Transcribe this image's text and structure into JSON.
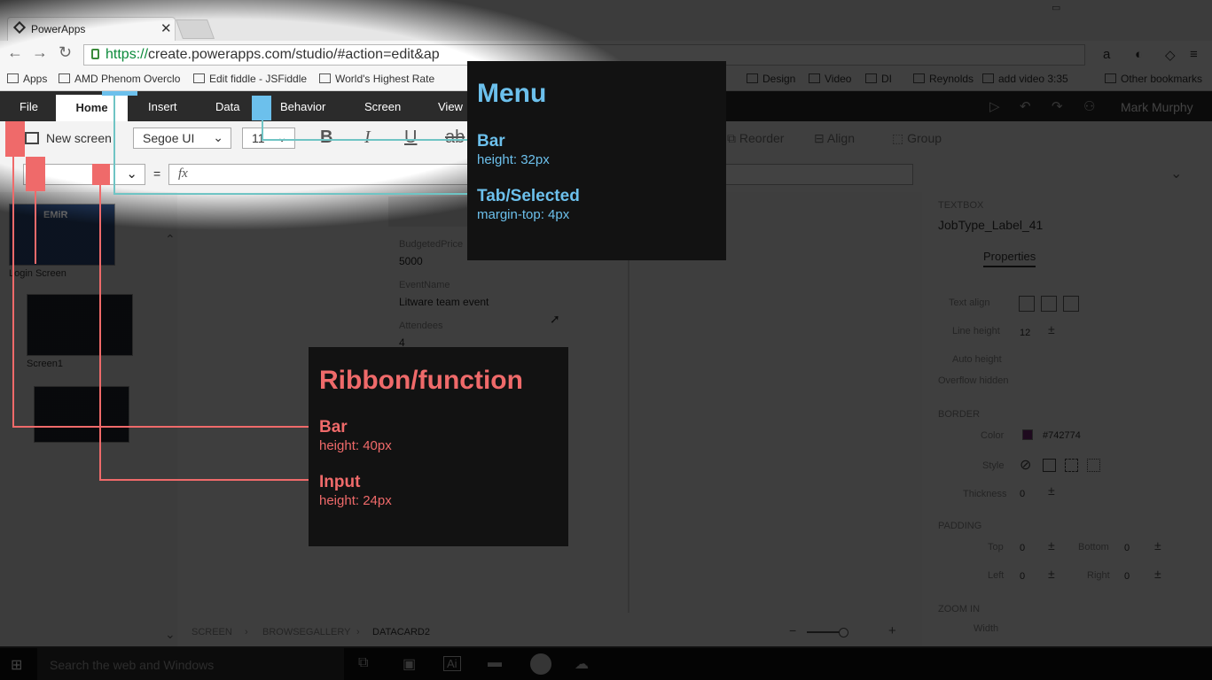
{
  "browser": {
    "tab_title": "PowerApps",
    "url_scheme": "https://",
    "url_rest": "create.powerapps.com/studio/#action=edit&ap",
    "bookmarks": [
      "Apps",
      "AMD Phenom Overclo",
      "Edit fiddle - JSFiddle",
      "World's Highest Rate",
      "Design",
      "Video",
      "DI",
      "Reynolds",
      "add video 3:35",
      "Other bookmarks"
    ]
  },
  "app": {
    "tabs": [
      "File",
      "Home",
      "Insert",
      "Data",
      "Behavior",
      "Screen",
      "View"
    ],
    "selected_tab": "Home",
    "user": "Mark Murphy",
    "ribbon": {
      "new_screen": "New screen",
      "font": "Segoe UI",
      "size": "11",
      "bold": "B",
      "italic": "I",
      "underline": "U",
      "strike": "ab",
      "reorder": "Reorder",
      "align": "Align",
      "group": "Group"
    },
    "formula": {
      "equals": "=",
      "fx": "fx"
    },
    "screens": [
      "Login Screen",
      "Screen1"
    ],
    "thumb_brand": "EMiR",
    "form": [
      {
        "label": "BudgetedPrice",
        "value": "5000"
      },
      {
        "label": "EventName",
        "value": "Litware team event"
      },
      {
        "label": "Attendees",
        "value": "4"
      }
    ],
    "properties": {
      "control_type": "TEXTBOX",
      "control_name": "JobType_Label_41",
      "tab": "Properties",
      "text_align": "Text align",
      "line_height_label": "Line height",
      "line_height": "12",
      "auto_height": "Auto height",
      "overflow": "Overflow hidden",
      "border_section": "BORDER",
      "color_label": "Color",
      "color_value": "#742774",
      "style_label": "Style",
      "thickness_label": "Thickness",
      "thickness": "0",
      "padding_section": "PADDING",
      "top": "Top",
      "bottom": "Bottom",
      "left": "Left",
      "right": "Right",
      "pad_value": "0",
      "zoom_section": "ZOOM IN",
      "zoom_sub": "Width"
    },
    "breadcrumb": [
      "SCREEN",
      "BROWSEGALLERY",
      "DATACARD2"
    ]
  },
  "taskbar": {
    "search": "Search the web and Windows",
    "ai_label": "Ai"
  },
  "annotations": {
    "menu": {
      "title": "Menu",
      "bar": "Bar",
      "bar_spec": "height: 32px",
      "tab": "Tab/Selected",
      "tab_spec": "margin-top: 4px"
    },
    "ribbon": {
      "title": "Ribbon/function",
      "bar": "Bar",
      "bar_spec": "height: 40px",
      "input": "Input",
      "input_spec": "height: 24px"
    }
  }
}
